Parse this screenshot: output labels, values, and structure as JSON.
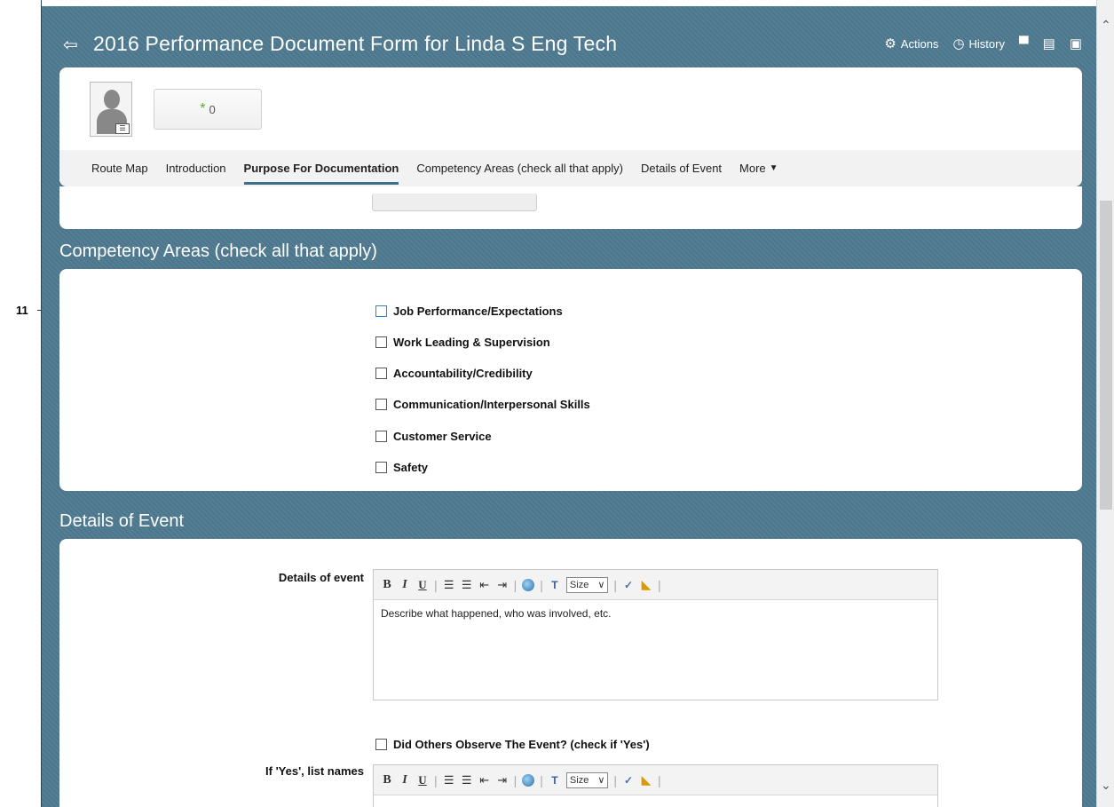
{
  "callout": {
    "number": "11"
  },
  "header": {
    "title": "2016 Performance Document Form for Linda S Eng Tech",
    "title_icon": "exit-icon",
    "actions_label": "Actions",
    "history_label": "History"
  },
  "profile": {
    "rating_value": "0"
  },
  "nav": {
    "items": [
      {
        "label": "Route Map"
      },
      {
        "label": "Introduction"
      },
      {
        "label": "Purpose For Documentation",
        "active": true
      },
      {
        "label": "Competency Areas (check all that apply)"
      },
      {
        "label": "Details of Event"
      },
      {
        "label": "More"
      }
    ]
  },
  "competency": {
    "title": "Competency Areas (check all that apply)",
    "items": [
      {
        "label": "Job Performance/Expectations",
        "checked": false
      },
      {
        "label": "Work Leading & Supervision",
        "checked": false
      },
      {
        "label": "Accountability/Credibility",
        "checked": false
      },
      {
        "label": "Communication/Interpersonal Skills",
        "checked": false
      },
      {
        "label": "Customer Service",
        "checked": false
      },
      {
        "label": "Safety",
        "checked": false
      }
    ]
  },
  "details": {
    "title": "Details of Event",
    "details_label": "Details of event",
    "details_text": "Describe what happened, who was involved, etc.",
    "observe_label": "Did Others Observe The Event? (check if 'Yes')",
    "names_label": "If 'Yes', list names",
    "toolbar": {
      "size_label": "Size"
    }
  },
  "colors": {
    "frame_bg": "#4f7a90",
    "nav_active_underline": "#3f6f86",
    "rating_star": "#5aa832"
  }
}
